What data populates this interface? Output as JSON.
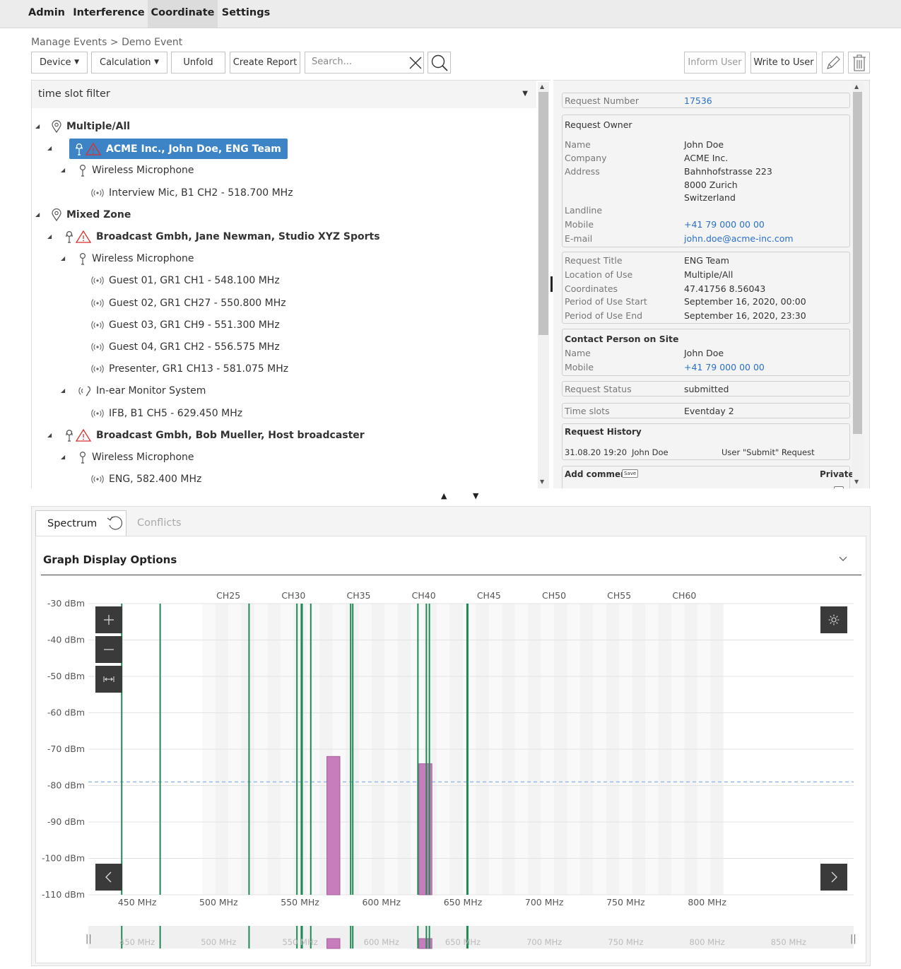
{
  "menu": {
    "items": [
      {
        "label": "Admin",
        "active": false
      },
      {
        "label": "Interference",
        "active": false
      },
      {
        "label": "Coordinate",
        "active": true
      },
      {
        "label": "Settings",
        "active": false
      }
    ]
  },
  "breadcrumb": "Manage Events > Demo Event",
  "toolbar": {
    "device": "Device",
    "calculation": "Calculation",
    "unfold": "Unfold",
    "create_report": "Create Report",
    "search_placeholder": "Search...",
    "inform_user": "Inform User",
    "write_to_user": "Write to User",
    "icons": {
      "clear": "close-icon",
      "search": "search-icon",
      "edit": "pencil-icon",
      "delete": "trash-icon"
    }
  },
  "filter": {
    "label": "time slot filter"
  },
  "tree": [
    {
      "label": "Multiple/All",
      "level": 0,
      "icon": "location-pin-icon",
      "bold": true,
      "expanded": true
    },
    {
      "label": "ACME Inc., John Doe, ENG Team",
      "level": 1,
      "icon": "microphone-warning-icon",
      "bold": true,
      "selected": true,
      "expanded": true
    },
    {
      "label": "Wireless Microphone",
      "level": 2,
      "icon": "microphone-icon",
      "expanded": true
    },
    {
      "label": "Interview Mic, B1 CH2 - 518.700 MHz",
      "level": 3,
      "icon": "signal-icon"
    },
    {
      "label": "Mixed Zone",
      "level": 0,
      "icon": "location-pin-icon",
      "bold": true,
      "expanded": true
    },
    {
      "label": "Broadcast Gmbh, Jane Newman, Studio XYZ Sports",
      "level": 1,
      "icon": "microphone-warning-icon",
      "bold": true,
      "expanded": true
    },
    {
      "label": "Wireless Microphone",
      "level": 2,
      "icon": "microphone-icon",
      "expanded": true
    },
    {
      "label": "Guest 01, GR1 CH1 - 548.100 MHz",
      "level": 3,
      "icon": "signal-icon"
    },
    {
      "label": "Guest 02, GR1 CH27 - 550.800 MHz",
      "level": 3,
      "icon": "signal-icon"
    },
    {
      "label": "Guest 03, GR1 CH9 - 551.300 MHz",
      "level": 3,
      "icon": "signal-icon"
    },
    {
      "label": "Guest 04, GR1 CH2 - 556.575 MHz",
      "level": 3,
      "icon": "signal-icon"
    },
    {
      "label": "Presenter, GR1 CH13 - 581.075 MHz",
      "level": 3,
      "icon": "signal-icon"
    },
    {
      "label": "In-ear Monitor System",
      "level": 2,
      "icon": "in-ear-icon",
      "expanded": true
    },
    {
      "label": "IFB, B1 CH5 - 629.450 MHz",
      "level": 3,
      "icon": "signal-icon"
    },
    {
      "label": "Broadcast Gmbh, Bob Mueller, Host broadcaster",
      "level": 1,
      "icon": "microphone-warning-icon",
      "bold": true,
      "expanded": true
    },
    {
      "label": "Wireless Microphone",
      "level": 2,
      "icon": "microphone-icon",
      "expanded": true
    },
    {
      "label": "ENG, 582.400 MHz",
      "level": 3,
      "icon": "signal-icon"
    }
  ],
  "details": {
    "request_number_label": "Request Number",
    "request_number": "17536",
    "owner_header": "Request Owner",
    "owner": {
      "name_label": "Name",
      "name": "John Doe",
      "company_label": "Company",
      "company": "ACME Inc.",
      "address_label": "Address",
      "address": [
        "Bahnhofstrasse 223",
        "8000 Zurich",
        "Switzerland"
      ],
      "landline_label": "Landline",
      "landline": "",
      "mobile_label": "Mobile",
      "mobile": "+41 79 000 00 00",
      "email_label": "E-mail",
      "email": "john.doe@acme-inc.com"
    },
    "request": {
      "title_label": "Request Title",
      "title": "ENG Team",
      "location_label": "Location of Use",
      "location": "Multiple/All",
      "coords_label": "Coordinates",
      "coords": "47.41756 8.56043",
      "start_label": "Period of Use Start",
      "start": "September 16, 2020, 00:00",
      "end_label": "Period of Use End",
      "end": "September 16, 2020, 23:30"
    },
    "contact": {
      "header": "Contact Person on Site",
      "name_label": "Name",
      "name": "John Doe",
      "mobile_label": "Mobile",
      "mobile": "+41 79 000 00 00"
    },
    "status_label": "Request Status",
    "status": "submitted",
    "timeslots_label": "Time slots",
    "timeslots": "Eventday 2",
    "history": {
      "header": "Request History",
      "rows": [
        {
          "date": "31.08.20 19:20",
          "user": "John Doe",
          "action": "User \"Submit\" Request"
        }
      ]
    },
    "comment": {
      "label": "Add comment",
      "save": "Save",
      "private": "Private"
    }
  },
  "tabs": [
    {
      "label": "Spectrum",
      "active": true
    },
    {
      "label": "Conflicts",
      "active": false
    }
  ],
  "graph_options_label": "Graph Display Options",
  "colors": {
    "selection": "#3d84c6",
    "carrier": "#1f8a55",
    "interference": "#c77dbb",
    "threshold": "#8fb8e8",
    "link": "#2a6fcf",
    "warning": "#d9302c"
  },
  "chart_data": {
    "type": "spectrum",
    "xlabel": "",
    "ylabel": "",
    "xlim": [
      420,
      890
    ],
    "ylim": [
      -110,
      -30
    ],
    "x_ticks": [
      450,
      500,
      550,
      600,
      650,
      700,
      750,
      800
    ],
    "x_tick_labels": [
      "450 MHz",
      "500 MHz",
      "550 MHz",
      "600 MHz",
      "650 MHz",
      "700 MHz",
      "750 MHz",
      "800 MHz"
    ],
    "y_ticks": [
      -30,
      -40,
      -50,
      -60,
      -70,
      -80,
      -90,
      -100,
      -110
    ],
    "y_tick_labels": [
      "-30 dBm",
      "-40 dBm",
      "-50 dBm",
      "-60 dBm",
      "-70 dBm",
      "-80 dBm",
      "-90 dBm",
      "-100 dBm",
      "-110 dBm"
    ],
    "channel_labels": [
      {
        "label": "CH25",
        "freq": 506
      },
      {
        "label": "CH30",
        "freq": 546
      },
      {
        "label": "CH35",
        "freq": 586
      },
      {
        "label": "CH40",
        "freq": 626
      },
      {
        "label": "CH45",
        "freq": 666
      },
      {
        "label": "CH50",
        "freq": 706
      },
      {
        "label": "CH55",
        "freq": 746
      },
      {
        "label": "CH60",
        "freq": 786
      }
    ],
    "channel_bands": {
      "start_freq": 490,
      "end_freq": 810,
      "width": 8
    },
    "threshold_dbm": -79,
    "carriers": [
      {
        "freq": 440.5,
        "bold": false
      },
      {
        "freq": 464.1,
        "bold": false
      },
      {
        "freq": 518.7,
        "bold": false
      },
      {
        "freq": 548.1,
        "bold": false
      },
      {
        "freq": 550.8,
        "bold": false
      },
      {
        "freq": 551.3,
        "bold": false
      },
      {
        "freq": 556.6,
        "bold": false
      },
      {
        "freq": 581.1,
        "bold": false
      },
      {
        "freq": 582.4,
        "bold": false
      },
      {
        "freq": 622.4,
        "bold": false
      },
      {
        "freq": 627.6,
        "bold": false
      },
      {
        "freq": 629.45,
        "bold": false
      },
      {
        "freq": 652.8,
        "bold": true
      }
    ],
    "interference": [
      {
        "from": 566.5,
        "to": 574.5,
        "level": -72
      },
      {
        "from": 623.0,
        "to": 631.0,
        "level": -74
      }
    ],
    "overview_ticks": [
      450,
      500,
      550,
      600,
      650,
      700,
      750,
      800,
      850
    ],
    "overview_tick_labels": [
      "450 MHz",
      "500 MHz",
      "550 MHz",
      "600 MHz",
      "650 MHz",
      "700 MHz",
      "750 MHz",
      "800 MHz",
      "850 MHz"
    ]
  }
}
